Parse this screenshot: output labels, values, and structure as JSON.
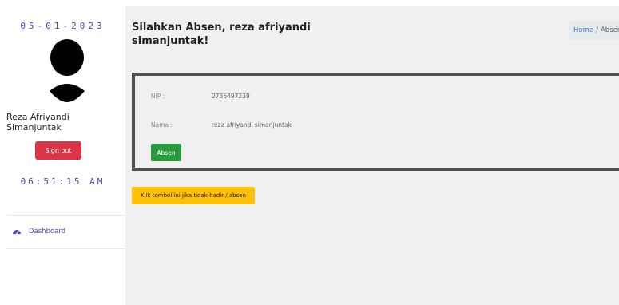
{
  "sidebar": {
    "date": "05-01-2023",
    "user_name": "Reza Afriyandi Simanjuntak",
    "signout_label": "Sign out",
    "clock": "06:51:15 AM",
    "nav": [
      {
        "label": "Dashboard",
        "icon": "dashboard-icon"
      }
    ]
  },
  "header": {
    "title": "Silahkan Absen, reza afriyandi simanjuntak!",
    "breadcrumb": {
      "home": "Home",
      "separator": "/",
      "current": "Absen"
    }
  },
  "card": {
    "nip_label": "NIP :",
    "nip_value": "2736497239",
    "nama_label": "Nama :",
    "nama_value": "reza afriyandi simanjuntak",
    "absen_label": "Absen"
  },
  "warning_button_label": "Klik tombol ini jika tidak hadir / absen",
  "colors": {
    "accent": "#4a46b8",
    "danger": "#dc3545",
    "success": "#2a9a3c",
    "warning": "#ffc107"
  }
}
